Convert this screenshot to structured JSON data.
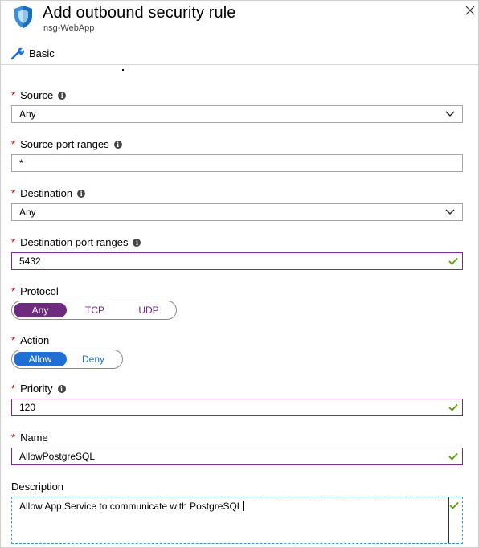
{
  "header": {
    "title": "Add outbound security rule",
    "subtitle": "nsg-WebApp",
    "icon": "shield-icon",
    "close_icon": "close-icon"
  },
  "tabs": {
    "basic_label": "Basic",
    "basic_icon": "wrench-icon"
  },
  "form": {
    "required_marker": "*",
    "info_glyph": "i",
    "source": {
      "label": "Source",
      "value": "Any"
    },
    "source_port_ranges": {
      "label": "Source port ranges",
      "value": "*"
    },
    "destination": {
      "label": "Destination",
      "value": "Any"
    },
    "destination_port_ranges": {
      "label": "Destination port ranges",
      "value": "5432"
    },
    "protocol": {
      "label": "Protocol",
      "options": [
        "Any",
        "TCP",
        "UDP"
      ],
      "selected": "Any"
    },
    "action": {
      "label": "Action",
      "options": [
        "Allow",
        "Deny"
      ],
      "selected": "Allow"
    },
    "priority": {
      "label": "Priority",
      "value": "120"
    },
    "name": {
      "label": "Name",
      "value": "AllowPostgreSQL"
    },
    "description": {
      "label": "Description",
      "value": "Allow App Service to communicate with PostgreSQL"
    }
  },
  "colors": {
    "accent_purple": "#6d2a7f",
    "accent_blue": "#1f6fd4",
    "required_red": "#cc0000",
    "valid_green": "#57a300",
    "shield_blue": "#3a8fd8"
  }
}
